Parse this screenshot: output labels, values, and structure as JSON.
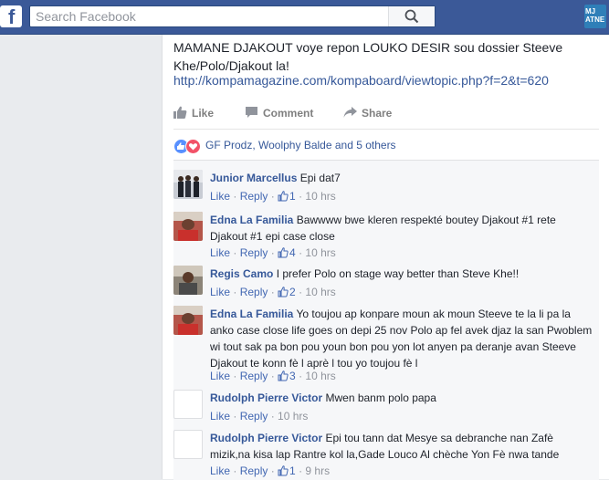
{
  "topbar": {
    "logo": "f",
    "search_placeholder": "Search Facebook",
    "app_icon_text": "MJ ATNE"
  },
  "post": {
    "text": "MAMANE DJAKOUT voye repon LOUKO DESIR sou dossier Steeve Khe/Polo/Djakout la!",
    "link": "http://kompamagazine.com/kompaboard/viewtopic.php?f=2&t=620",
    "actions": {
      "like": "Like",
      "comment": "Comment",
      "share": "Share"
    },
    "reactions_text": "GF Prodz, Woolphy Balde and 5 others"
  },
  "comments": [
    {
      "author": "Junior Marcellus",
      "text": "Epi dat7",
      "like": "Like",
      "reply": "Reply",
      "likes": "1",
      "time": "10 hrs"
    },
    {
      "author": "Edna La Familia",
      "text": "Bawwww bwe kleren respekté boutey Djakout #1 rete Djakout #1 epi case close",
      "like": "Like",
      "reply": "Reply",
      "likes": "4",
      "time": "10 hrs"
    },
    {
      "author": "Regis Camo",
      "text": "I prefer Polo on stage way better than Steve Khe!!",
      "like": "Like",
      "reply": "Reply",
      "likes": "2",
      "time": "10 hrs"
    },
    {
      "author": "Edna La Familia",
      "text": "Yo toujou ap konpare moun ak moun Steeve te la li pa la anko case close life goes on depi 25 nov Polo ap fel avek djaz la san Pwoblem wi tout sak pa bon pou youn bon pou yon lot anyen pa deranje avan Steeve Djakout te konn fè l aprè l tou yo toujou fè l",
      "like": "Like",
      "reply": "Reply",
      "likes": "3",
      "time": "10 hrs"
    },
    {
      "author": "Rudolph Pierre Victor",
      "text": "Mwen banm polo papa",
      "like": "Like",
      "reply": "Reply",
      "likes": "",
      "time": "10 hrs"
    },
    {
      "author": "Rudolph Pierre Victor",
      "text": "Epi tou tann dat Mesye sa debranche nan Zafè mizik,na kisa lap Rantre kol la,Gade Louco Al chèche Yon Fè nwa tande",
      "like": "Like",
      "reply": "Reply",
      "likes": "1",
      "time": "9 hrs"
    }
  ]
}
